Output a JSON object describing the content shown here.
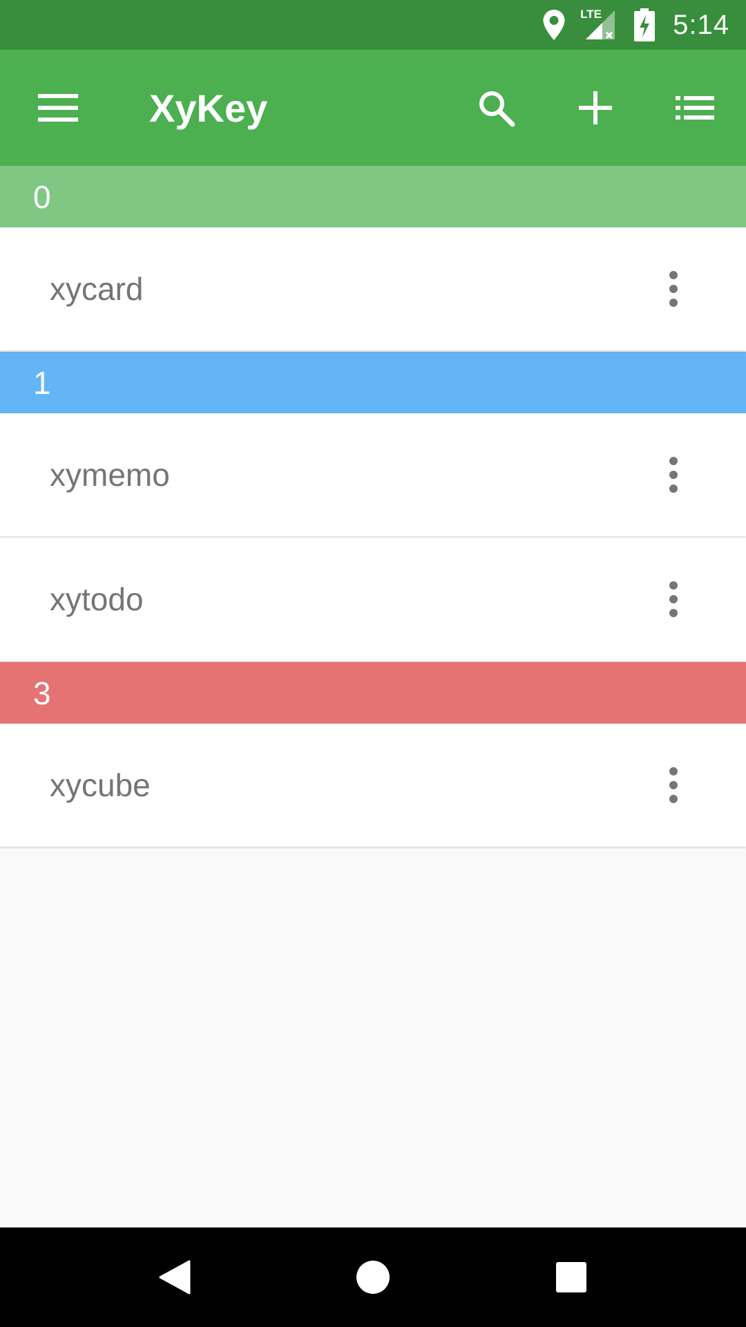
{
  "status_bar": {
    "time": "5:14",
    "network_label": "LTE",
    "icons": [
      "location-icon",
      "lte-signal-icon",
      "battery-charging-icon"
    ]
  },
  "app_bar": {
    "title": "XyKey",
    "icons": [
      "menu-icon",
      "search-icon",
      "add-icon",
      "list-view-icon"
    ]
  },
  "sections": [
    {
      "header": "0",
      "color": "#81c784",
      "items": [
        "xycard"
      ]
    },
    {
      "header": "1",
      "color": "#64b5f6",
      "items": [
        "xymemo",
        "xytodo"
      ]
    },
    {
      "header": "3",
      "color": "#e57373",
      "items": [
        "xycube"
      ]
    }
  ],
  "item_icon": "more-vert-icon",
  "nav_bar": {
    "icons": [
      "back-icon",
      "home-icon",
      "recents-icon"
    ]
  },
  "colors": {
    "status_bar": "#388e3c",
    "app_bar": "#4caf50",
    "background": "#f9f9f9",
    "item_text": "#757575"
  }
}
